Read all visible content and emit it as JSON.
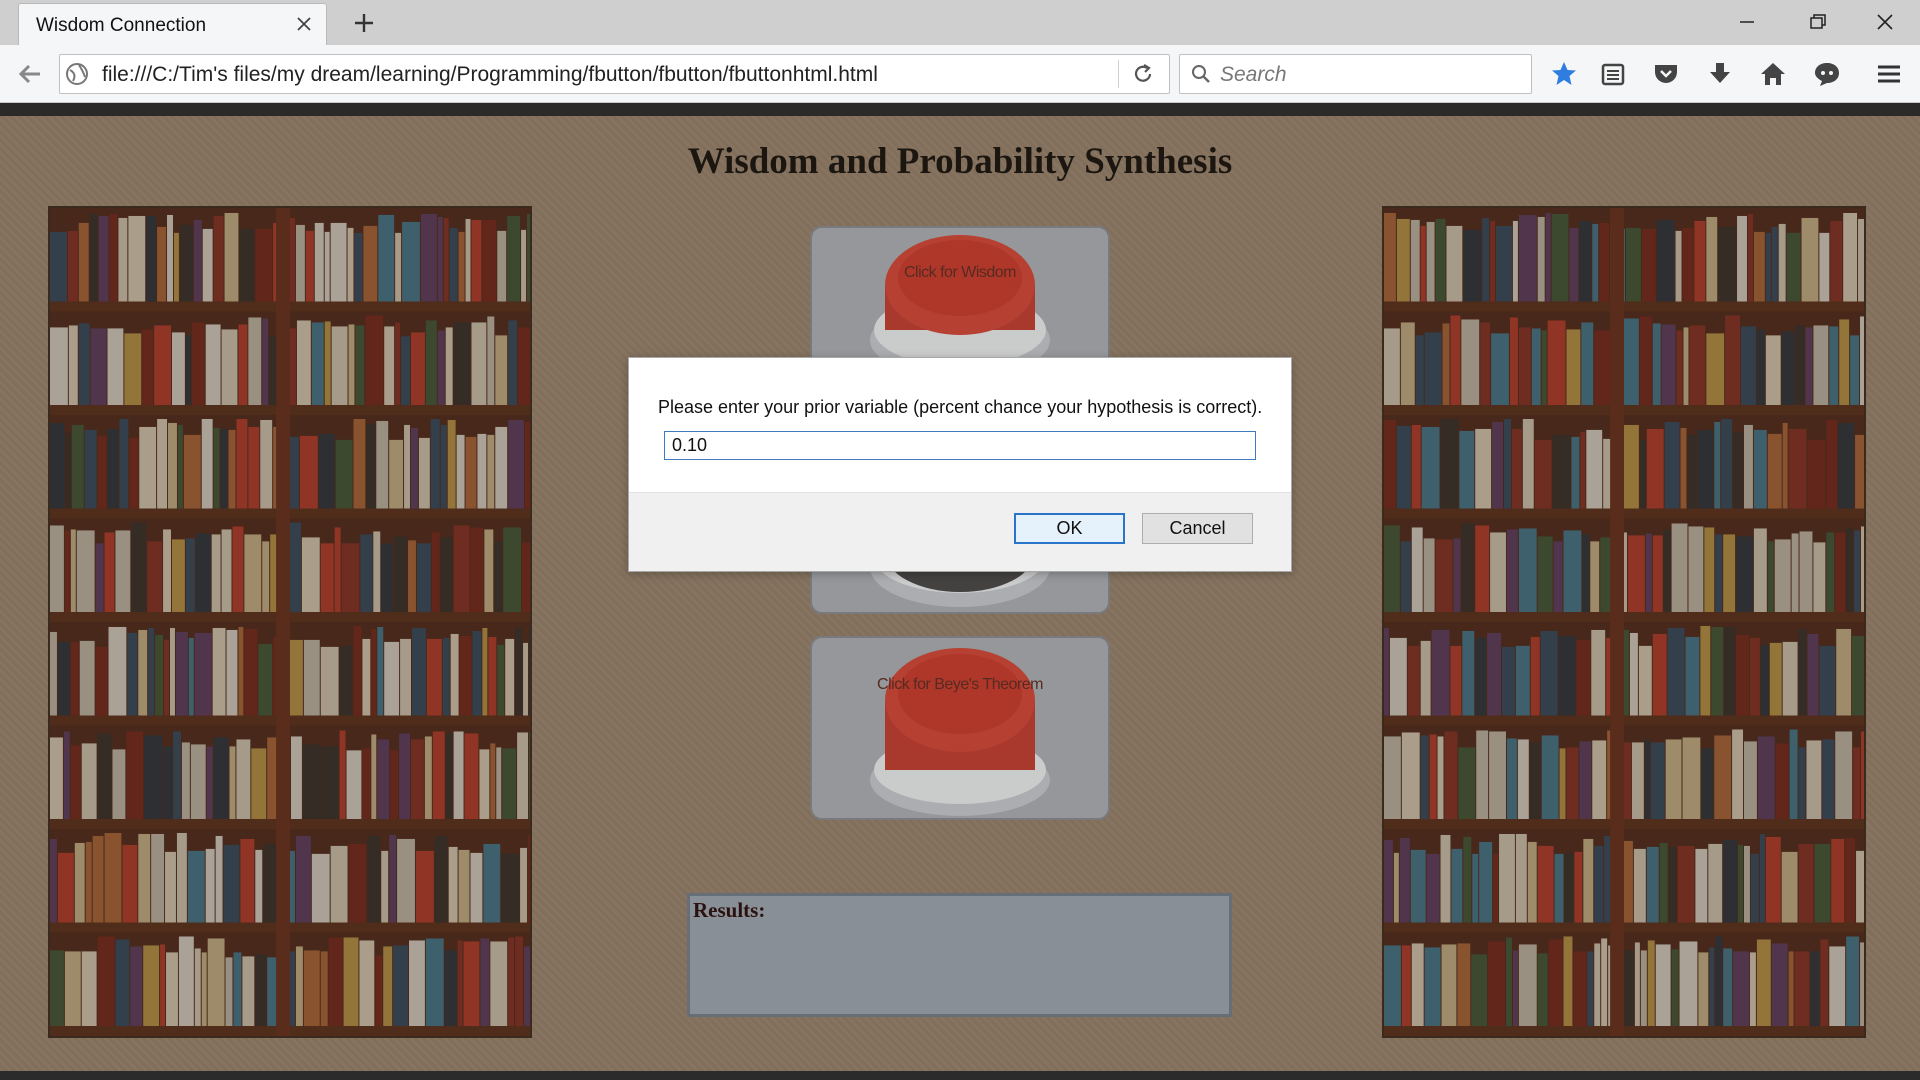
{
  "browser": {
    "tab_title": "Wisdom Connection",
    "url": "file:///C:/Tim's files/my dream/learning/Programming/fbutton/fbutton/fbuttonhtml.html",
    "search_placeholder": "Search"
  },
  "page": {
    "title": "Wisdom and Probability Synthesis",
    "buttons": [
      {
        "label": "Click for Wisdom"
      },
      {
        "label": ""
      },
      {
        "label": "Click for Beye's Theorem"
      }
    ],
    "results_label": "Results:"
  },
  "dialog": {
    "message": "Please enter your prior variable (percent chance your hypothesis is correct).",
    "input_value": "0.10",
    "ok_label": "OK",
    "cancel_label": "Cancel"
  },
  "colors": {
    "page_background": "#8a7763",
    "button_red": "#b8382c",
    "accent_blue": "#2a74c9"
  }
}
